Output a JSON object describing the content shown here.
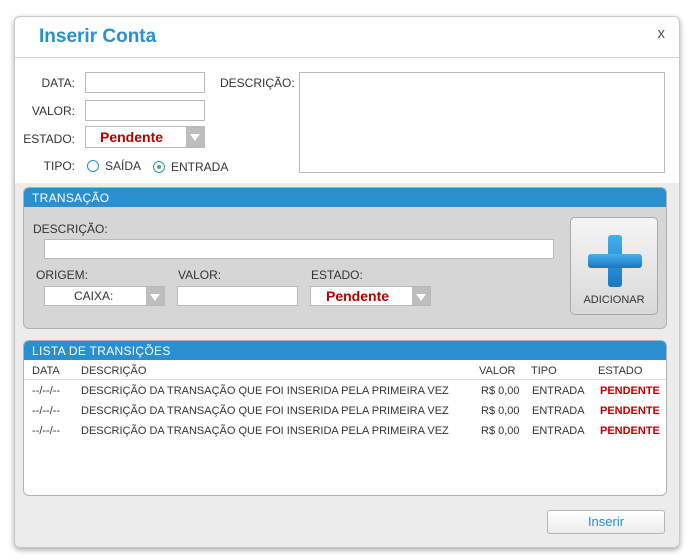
{
  "dialog": {
    "title": "Inserir Conta",
    "close": "x"
  },
  "form": {
    "data_label": "DATA:",
    "valor_label": "VALOR:",
    "estado_label": "ESTADO:",
    "estado_value": "Pendente",
    "tipo_label": "TIPO:",
    "tipo_options": [
      "SAÍDA",
      "ENTRADA"
    ],
    "tipo_selected": "ENTRADA",
    "descricao_label": "DESCRIÇÃO:"
  },
  "transacao": {
    "header": "TRANSAÇÃO",
    "descricao_label": "DESCRIÇÃO:",
    "origem_label": "ORIGEM:",
    "origem_value": "CAIXA:",
    "valor_label": "VALOR:",
    "estado_label": "ESTADO:",
    "estado_value": "Pendente",
    "add_button": "ADICIONAR"
  },
  "lista": {
    "header": "LISTA DE TRANSIÇÕES",
    "columns": [
      "DATA",
      "DESCRIÇÃO",
      "VALOR",
      "TIPO",
      "ESTADO"
    ],
    "rows": [
      {
        "data": "--/--/--",
        "descricao": "DESCRIÇÃO DA TRANSAÇÃO QUE FOI INSERIDA PELA PRIMEIRA VEZ",
        "valor": "R$ 0,00",
        "tipo": "ENTRADA",
        "estado": "PENDENTE"
      },
      {
        "data": "--/--/--",
        "descricao": "DESCRIÇÃO DA TRANSAÇÃO QUE FOI INSERIDA PELA PRIMEIRA VEZ",
        "valor": "R$ 0,00",
        "tipo": "ENTRADA",
        "estado": "PENDENTE"
      },
      {
        "data": "--/--/--",
        "descricao": "DESCRIÇÃO DA TRANSAÇÃO QUE FOI INSERIDA PELA PRIMEIRA VEZ",
        "valor": "R$ 0,00",
        "tipo": "ENTRADA",
        "estado": "PENDENTE"
      }
    ]
  },
  "footer": {
    "insert_button": "Inserir"
  },
  "colors": {
    "accent": "#2a8fcf",
    "status_pending": "#c00000",
    "add_icon": "#1a76c2"
  },
  "icons": {
    "close": "close-icon",
    "add": "plus-icon",
    "dropdown": "chevron-down-icon"
  }
}
